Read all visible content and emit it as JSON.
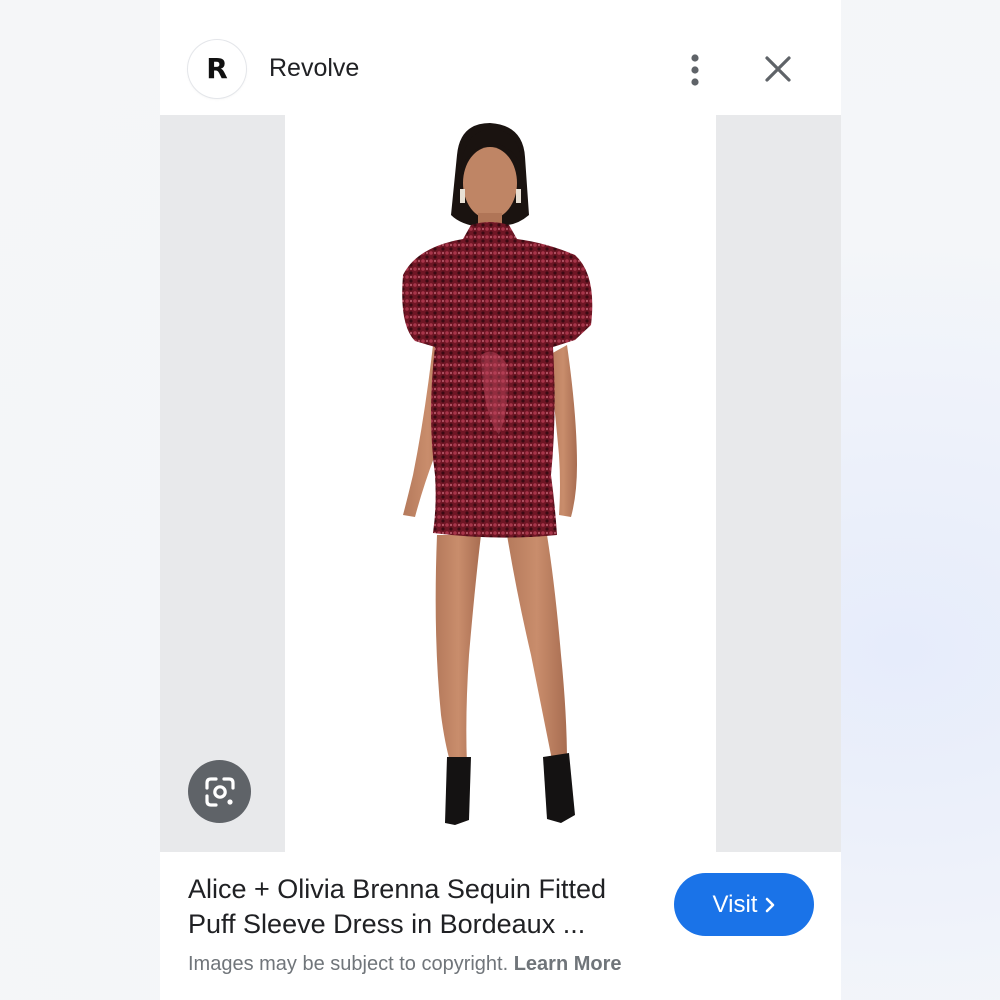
{
  "header": {
    "logo_letter": "R",
    "site_name": "Revolve",
    "more_icon": "more-vert-icon",
    "close_icon": "close-icon"
  },
  "image": {
    "subject": "Model wearing burgundy sequin fitted puff sleeve mini dress",
    "lens_icon": "google-lens-icon"
  },
  "footer": {
    "title": "Alice + Olivia Brenna Sequin Fitted Puff Sleeve Dress in Bordeaux ...",
    "visit_label": "Visit",
    "visit_icon": "chevron-right-icon",
    "copyright_text": "Images may be subject to copyright.",
    "learn_more": "Learn More"
  },
  "colors": {
    "accent": "#1a73e8",
    "dress": "#7a1a2a",
    "lens_button": "#5f6368"
  }
}
